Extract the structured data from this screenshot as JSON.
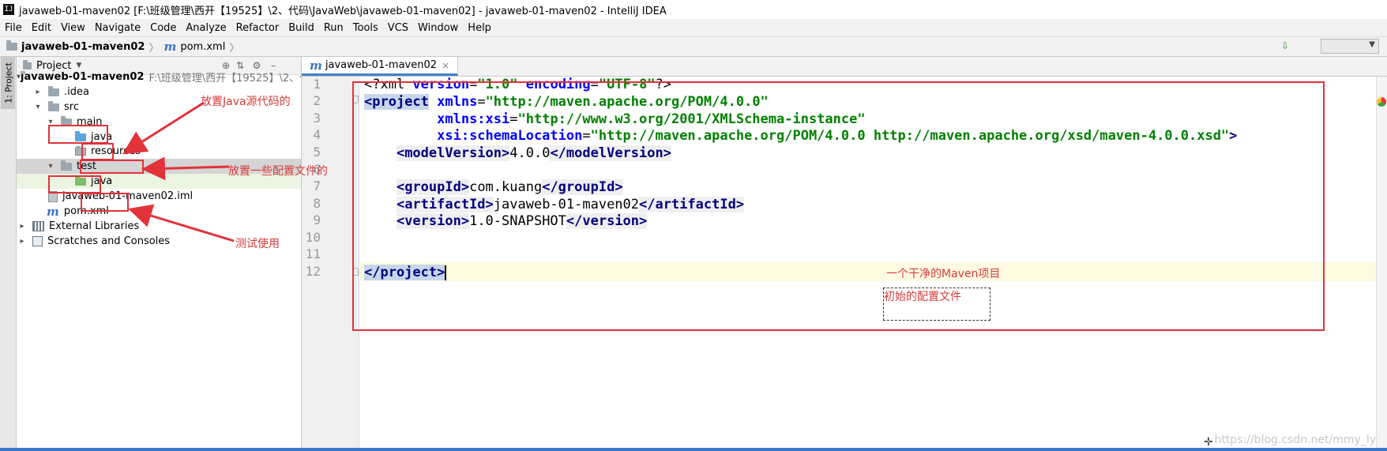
{
  "window": {
    "title": "javaweb-01-maven02 [F:\\班级管理\\西开【19525】\\2、代码\\JavaWeb\\javaweb-01-maven02] - javaweb-01-maven02 - IntelliJ IDEA",
    "app_icon": "IJ"
  },
  "menu": [
    "File",
    "Edit",
    "View",
    "Navigate",
    "Code",
    "Analyze",
    "Refactor",
    "Build",
    "Run",
    "Tools",
    "VCS",
    "Window",
    "Help"
  ],
  "breadcrumb": {
    "project": "javaweb-01-maven02",
    "file": "pom.xml"
  },
  "left_stripe": {
    "label": "1: Project"
  },
  "project_panel": {
    "title": "Project",
    "dropdown_icon": "chevron-down-icon",
    "tree": {
      "root_name": "javaweb-01-maven02",
      "root_path": "F:\\班级管理\\西开【19525】\\2、代",
      "idea": ".idea",
      "src": "src",
      "main": "main",
      "main_java": "java",
      "resources": "resources",
      "test": "test",
      "test_java": "java",
      "iml": "javaweb-01-maven02.iml",
      "pom": "pom.xml",
      "external_libraries": "External Libraries",
      "scratches": "Scratches and Consoles"
    }
  },
  "editor": {
    "tab_label": "javaweb-01-maven02",
    "line_numbers": [
      "1",
      "2",
      "3",
      "4",
      "5",
      "6",
      "7",
      "8",
      "9",
      "10",
      "11",
      "12"
    ],
    "code": {
      "l1_pi_open": "<?xml ",
      "l1_attr1": "version",
      "l1_eq1": "=",
      "l1_val1": "\"1.0\"",
      "l1_attr2": " encoding",
      "l1_eq2": "=",
      "l1_val2": "\"UTF-8\"",
      "l1_pi_close": "?>",
      "l2_tag": "<project",
      "l2_attr": " xmlns",
      "l2_eq": "=",
      "l2_val": "\"http://maven.apache.org/POM/4.0.0\"",
      "l3_indent": "         ",
      "l3_attr": "xmlns:xsi",
      "l3_eq": "=",
      "l3_val": "\"http://www.w3.org/2001/XMLSchema-instance\"",
      "l4_indent": "         ",
      "l4_attr": "xsi:schemaLocation",
      "l4_eq": "=",
      "l4_val": "\"http://maven.apache.org/POM/4.0.0 http://maven.apache.org/xsd/maven-4.0.0.xsd\"",
      "l4_close": ">",
      "indent": "    ",
      "l5_open": "<modelVersion>",
      "l5_text": "4.0.0",
      "l5_close": "</modelVersion>",
      "l7_open": "<groupId>",
      "l7_text": "com.kuang",
      "l7_close": "</groupId>",
      "l8_open": "<artifactId>",
      "l8_text": "javaweb-01-maven02",
      "l8_close": "</artifactId>",
      "l9_open": "<version>",
      "l9_text": "1.0-SNAPSHOT",
      "l9_close": "</version>",
      "l12_close": "</project>"
    }
  },
  "annotations": {
    "java_source": "放置Java源代码的",
    "resources_config": "放置一些配置文件的",
    "test_use": "测试使用",
    "clean_project": "一个干净的Maven项目",
    "initial_config": "初始的配置文件"
  },
  "watermark": "https://blog.csdn.net/mmy_ly",
  "colors": {
    "annotation_red": "#e2323a",
    "xml_tag": "#000080",
    "xml_attr": "#0000ff",
    "xml_string": "#008000",
    "selected_row": "#d5d5d5",
    "test_row": "#ebf5e1"
  }
}
